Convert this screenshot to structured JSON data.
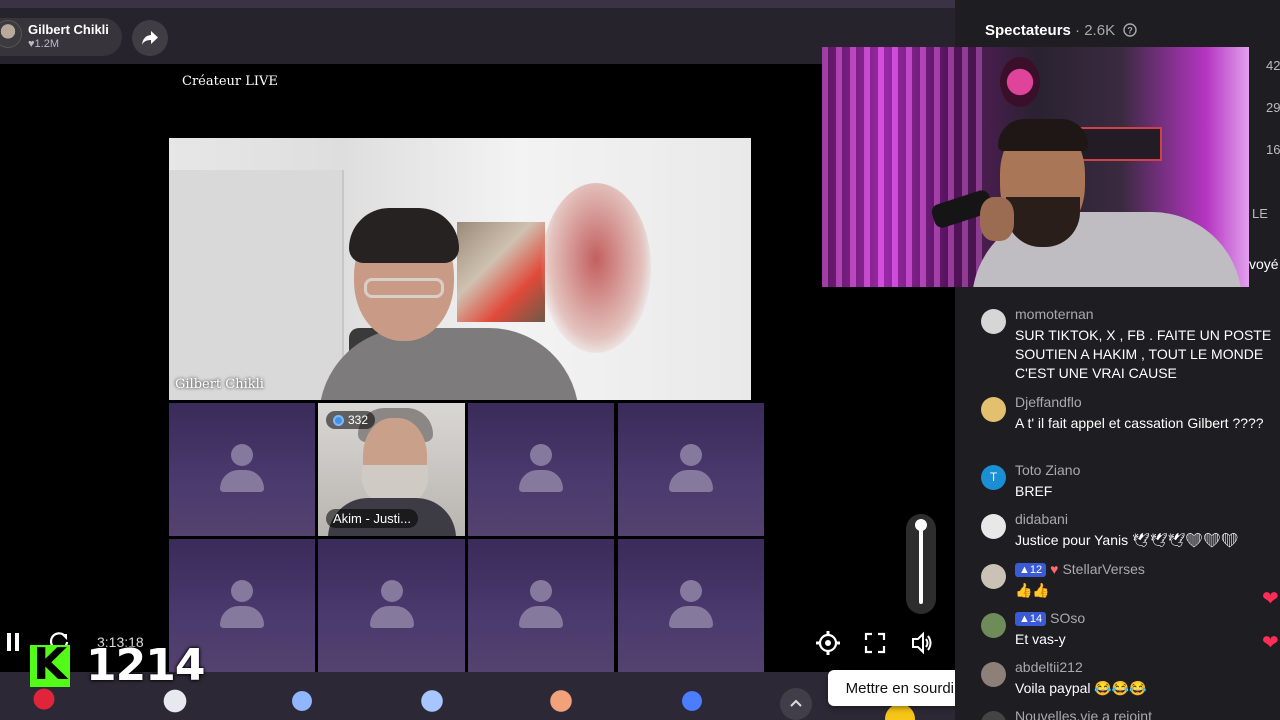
{
  "header": {
    "creator_name": "Gilbert Chikli",
    "creator_likes": "♥1.2M"
  },
  "stream": {
    "live_label": "Créateur LIVE",
    "main_video_name": "Gilbert Chikli",
    "guest_badge_count": "332",
    "guest_name": "Akim - Justi...",
    "elapsed_time": "3:13:18",
    "kick_logo_letter": "K",
    "kick_viewer_count": "1214",
    "tooltip": "Mettre en sourdine (M)",
    "volume_level_percent": 100
  },
  "colors": {
    "kick_green": "#53fc18",
    "tile_purple": "#4a3a6e",
    "level_badge_blue": "#3b5bd6",
    "heart_red": "#ff2d55"
  },
  "side": {
    "title": "Spectateurs",
    "viewer_count": "2.6K",
    "edge_numbers": [
      "42",
      "29",
      "16"
    ],
    "edge_text_le": "LE",
    "edge_text_voye": "voyé"
  },
  "chat": {
    "messages": [
      {
        "user": "momoternan",
        "text": "SUR TIKTOK, X , FB . FAITE UN POSTE SOUTIEN A HAKIM , TOUT LE MONDE C'EST UNE VRAI CAUSE",
        "level": ""
      },
      {
        "user": "Djeffandflo",
        "text": "A t' il fait appel et cassation Gilbert ????",
        "level": ""
      },
      {
        "user": "Toto Ziano",
        "text": "BREF",
        "level": "",
        "avatar_letter": "T"
      },
      {
        "user": "didabani",
        "text": "Justice pour Yanis 🕊🕊🕊❤❤❤",
        "level": ""
      },
      {
        "user": "StellarVerses",
        "text": "👍👍",
        "level": "12"
      },
      {
        "user": "SOso",
        "text": "Et vas-y",
        "level": "14"
      },
      {
        "user": "abdeltii212",
        "text": "Voila paypal 😂😂😂",
        "level": ""
      },
      {
        "user": "Nouvelles.vie",
        "text": "a rejoint",
        "level": ""
      }
    ]
  },
  "icons": [
    "share-icon",
    "pause-icon",
    "reload-icon",
    "settings-icon",
    "fullscreen-icon",
    "volume-icon",
    "chevron-up-icon",
    "help-icon",
    "heart-icon"
  ]
}
